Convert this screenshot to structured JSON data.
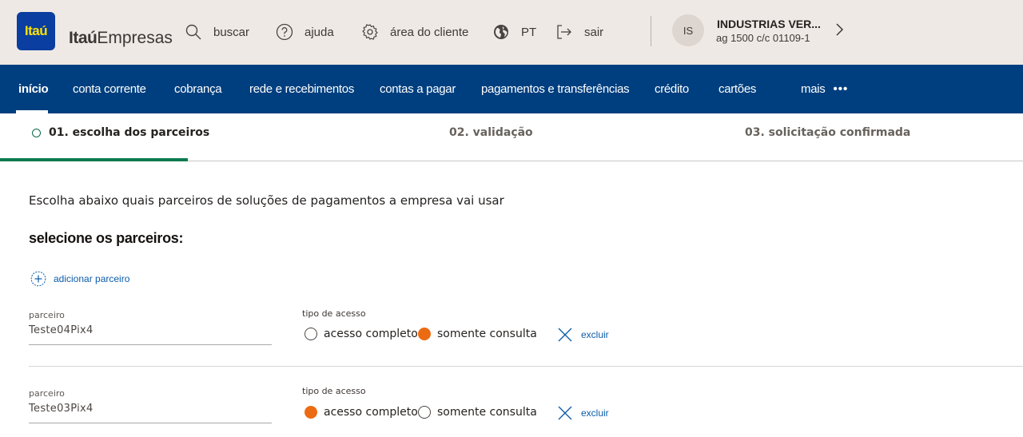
{
  "header": {
    "logo_text": "Itaú",
    "brand_bold": "Itaú",
    "brand_light": "Empresas",
    "tools": [
      {
        "label": "buscar",
        "icon": "search-icon"
      },
      {
        "label": "ajuda",
        "icon": "help-icon"
      },
      {
        "label": "área do cliente",
        "icon": "gear-icon"
      },
      {
        "label": "PT",
        "icon": "globe-icon"
      },
      {
        "label": "sair",
        "icon": "logout-icon"
      }
    ],
    "account": {
      "initials": "IS",
      "name": "INDUSTRIAS VER...",
      "agency": "ag 1500  c/c 01109-1"
    }
  },
  "nav": {
    "items": [
      {
        "label": "início",
        "active": true
      },
      {
        "label": "conta corrente"
      },
      {
        "label": "cobrança"
      },
      {
        "label": "rede e recebimentos"
      },
      {
        "label": "contas a pagar"
      },
      {
        "label": "pagamentos e transferências"
      },
      {
        "label": "crédito"
      },
      {
        "label": "cartões"
      },
      {
        "label": "mais"
      }
    ],
    "more_dots": "•••"
  },
  "steps": [
    {
      "label": "01. escolha dos parceiros",
      "current": true
    },
    {
      "label": "02. validação"
    },
    {
      "label": "03. solicitação confirmada"
    }
  ],
  "content": {
    "intro": "Escolha abaixo quais parceiros de soluções de pagamentos a empresa vai usar",
    "section_title": "selecione os parceiros:",
    "add_partner": "adicionar parceiro",
    "partner_label": "parceiro",
    "access_label": "tipo de acesso",
    "option_full": "acesso completo",
    "option_readonly": "somente consulta",
    "delete_label": "excluir",
    "partners": [
      {
        "name": "Teste04Pix4",
        "access": "somente consulta"
      },
      {
        "name": "Teste03Pix4",
        "access": "acesso completo"
      }
    ]
  },
  "colors": {
    "nav_bg": "#003f7f",
    "topbar_bg": "#efe9e5",
    "accent_orange": "#ec6b12",
    "link_blue": "#0b5ca8",
    "progress_green": "#0b7a50",
    "logo_blue": "#0a3ea0",
    "logo_yellow": "#ffe200"
  }
}
